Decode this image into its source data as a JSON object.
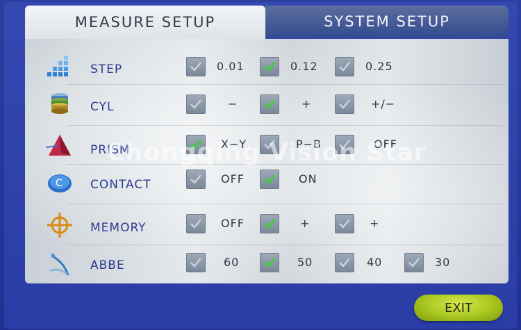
{
  "tabs": {
    "measure_setup": "MEASURE SETUP",
    "system_setup": "SYSTEM SETUP"
  },
  "watermark": "Chongqing Vision Star",
  "rows": [
    {
      "label": "STEP",
      "icon": "bars-icon",
      "options": [
        {
          "label": "0.01",
          "checked": false
        },
        {
          "label": "0.12",
          "checked": true
        },
        {
          "label": "0.25",
          "checked": false
        }
      ]
    },
    {
      "label": "CYL",
      "icon": "cylinder-icon",
      "options": [
        {
          "label": "−",
          "checked": false
        },
        {
          "label": "+",
          "checked": true
        },
        {
          "label": "+/−",
          "checked": false
        }
      ]
    },
    {
      "label": "PRISM",
      "icon": "prism-icon",
      "options": [
        {
          "label": "X−Y",
          "checked": true
        },
        {
          "label": "P−B",
          "checked": false
        },
        {
          "label": "OFF",
          "checked": false
        }
      ]
    },
    {
      "label": "CONTACT",
      "icon": "contact-lens-icon",
      "options": [
        {
          "label": "OFF",
          "checked": false
        },
        {
          "label": "ON",
          "checked": true
        }
      ]
    },
    {
      "label": "MEMORY",
      "icon": "crosshair-icon",
      "options": [
        {
          "label": "OFF",
          "checked": false
        },
        {
          "label": "+",
          "checked": true
        },
        {
          "label": "+",
          "checked": false
        }
      ]
    },
    {
      "label": "ABBE",
      "icon": "abbe-icon",
      "options": [
        {
          "label": "60",
          "checked": false
        },
        {
          "label": "50",
          "checked": true
        },
        {
          "label": "40",
          "checked": false
        },
        {
          "label": "30",
          "checked": false
        }
      ]
    }
  ],
  "exit_label": "EXIT",
  "colors": {
    "check_on": "#3fcf3a",
    "check_off": "#c9d2de",
    "label": "#2b3b8f",
    "exit": "#a8c61f"
  }
}
